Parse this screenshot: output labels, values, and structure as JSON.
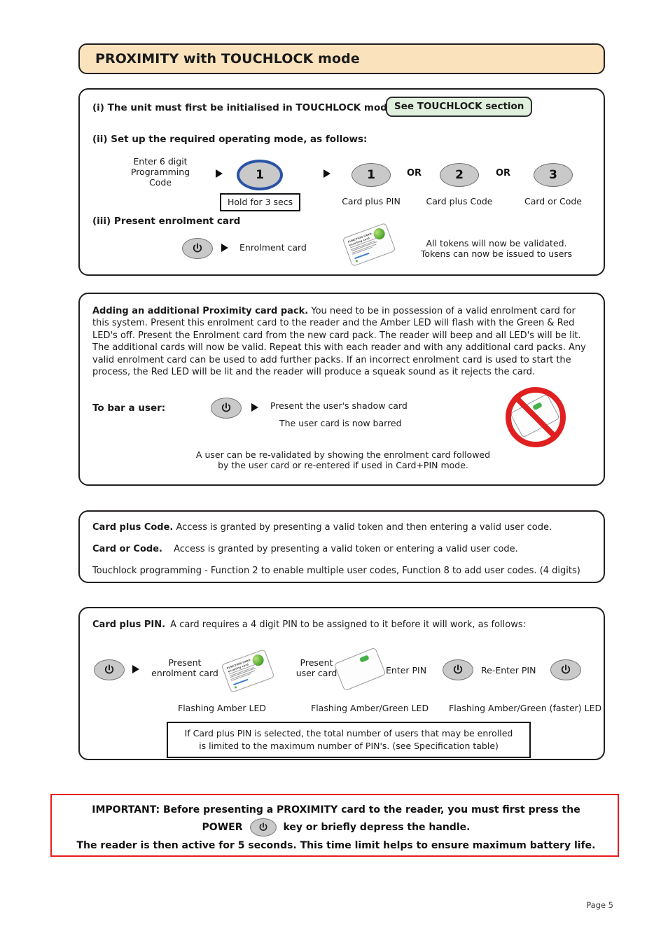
{
  "header": {
    "title": "PROXIMITY with TOUCHLOCK mode"
  },
  "setup_section": {
    "step_i": {
      "text": "(i) The unit must first be initialised in TOUCHLOCK mode:",
      "badge": "See TOUCHLOCK section"
    },
    "step_ii": {
      "text": "(ii) Set up the required operating mode, as follows:",
      "enter_code_line1": "Enter 6 digit",
      "enter_code_line2": "Programming",
      "enter_code_line3": "Code",
      "hold_button": "1",
      "hold_note": "Hold for 3 secs",
      "or_1": "OR",
      "or_2": "OR",
      "options": [
        {
          "digit": "1",
          "label": "Card plus PIN"
        },
        {
          "digit": "2",
          "label": "Card plus Code"
        },
        {
          "digit": "3",
          "label": "Card or Code"
        }
      ]
    },
    "step_iii": {
      "text": "(iii) Present enrolment card",
      "enrolment_label": "Enrolment card",
      "result_line1": "All tokens will now be validated.",
      "result_line2": "Tokens can now be issued to users"
    }
  },
  "add_pack_section": {
    "heading": "Adding an additional Proximity card pack.",
    "body": "You need to be in possession of a valid enrolment card for this system.  Present this enrolment card to the reader and the Amber LED will flash with the Green & Red LED's off. Present the Enrolment card from the new card pack. The reader will beep and all LED's will be lit. The additional cards will now be valid. Repeat this with each reader and with any additional card packs. Any valid enrolment card can be used to add further packs. If an incorrect enrolment card is used to start the process, the Red LED will be lit and the reader will produce a squeak sound as it rejects the card.",
    "bar_user_label": "To bar a user:",
    "bar_line1": "Present the user's shadow card",
    "bar_line2": "The user card is now barred",
    "revalidate_line1": "A user can be re-validated by showing the enrolment card followed",
    "revalidate_line2": "by the user card or re-entered if used in Card+PIN mode."
  },
  "code_section": {
    "card_plus_code_label": "Card plus Code.",
    "card_plus_code_text": "Access is granted by presenting a valid token and then entering a valid user code.",
    "card_or_code_label": "Card or Code.",
    "card_or_code_text": "Access is granted by presenting a valid token or entering a valid user code.",
    "touchlock_note": "Touchlock programming - Function 2 to enable multiple user codes, Function 8 to add user codes. (4 digits)"
  },
  "pin_section": {
    "heading": "Card plus PIN.",
    "intro": "A card requires a 4 digit PIN to be assigned to it before it will work, as follows:",
    "present_enrolment_line1": "Present",
    "present_enrolment_line2": "enrolment card",
    "present_user_line1": "Present",
    "present_user_line2": "user card",
    "enter_pin": "Enter PIN",
    "re_enter_pin": "Re-Enter PIN",
    "led_1": "Flashing Amber LED",
    "led_2": "Flashing Amber/Green LED",
    "led_3": "Flashing Amber/Green (faster) LED",
    "note_line1": "If Card plus PIN is selected, the total number of users that may be enrolled",
    "note_line2": "is limited to the maximum number of PIN's. (see Specification table)"
  },
  "important": {
    "line1": "IMPORTANT:  Before presenting a PROXIMITY card to the reader, you must first press the",
    "line2_a": "POWER",
    "line2_b": "key or briefly depress the handle.",
    "line3": "The reader is then active for 5 seconds. This time limit helps to ensure maximum battery life."
  },
  "footer": {
    "page": "Page  5"
  },
  "card_art": {
    "brand_line1": "FUNCTION CARD",
    "brand_line2": "enrolling card",
    "foot": "www.example"
  },
  "colors": {
    "header_bg": "#fae2bd",
    "badge_bg": "#dff0dc",
    "important_border": "#e81b1b",
    "ring_blue": "#2a53a8",
    "button_gray": "#c9c9c9",
    "chip_green": "#45b04a"
  }
}
